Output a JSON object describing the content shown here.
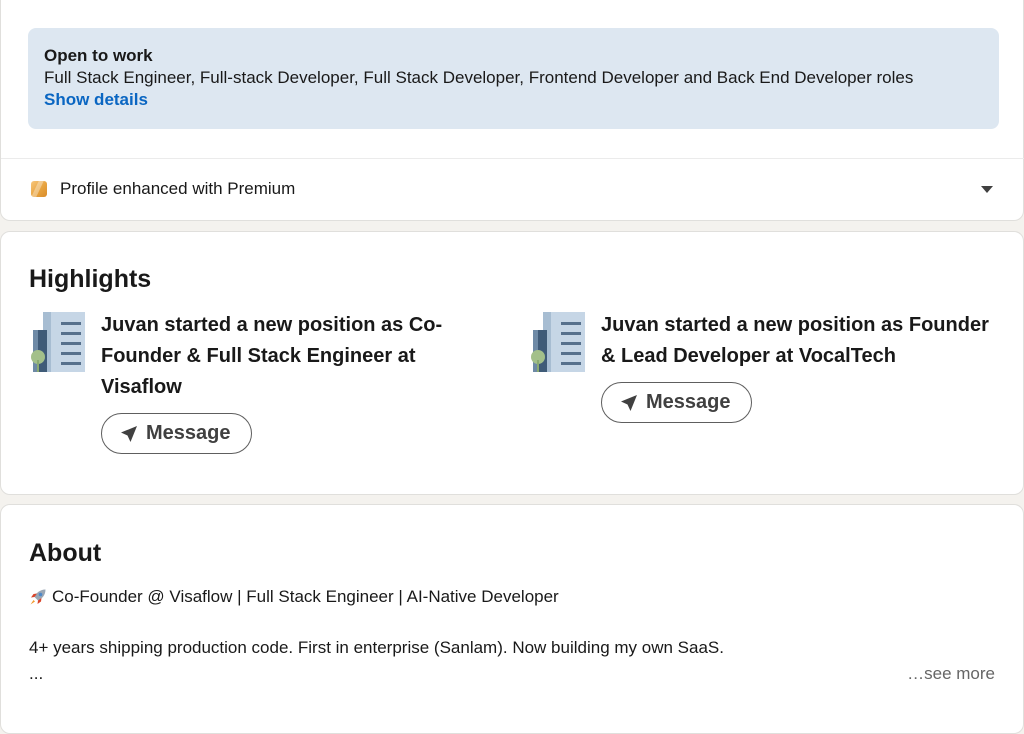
{
  "open_to_work": {
    "title": "Open to work",
    "roles": "Full Stack Engineer, Full-stack Developer, Full Stack Developer, Frontend Developer and Back End Developer roles",
    "link": "Show details"
  },
  "premium": {
    "label": "Profile enhanced with Premium",
    "icon": "premium-icon",
    "expand_icon": "chevron-down-icon"
  },
  "highlights": {
    "title": "Highlights",
    "items": [
      {
        "text": "Juvan started a new position as Co-Founder & Full Stack Engineer at Visaflow",
        "button": "Message",
        "icon": "company-building-icon"
      },
      {
        "text": "Juvan started a new position as Founder & Lead Developer at VocalTech",
        "button": "Message",
        "icon": "company-building-icon"
      }
    ]
  },
  "about": {
    "title": "About",
    "line1": "Co-Founder @ Visaflow | Full Stack Engineer | AI-Native Developer",
    "line2": "4+ years shipping production code. First in enterprise (Sanlam). Now building my own SaaS.",
    "line3": "...",
    "see_more": "…see more"
  },
  "colors": {
    "link": "#0a66c2",
    "open_to_work_bg": "#dde7f1",
    "page_bg": "#f4f2ee"
  }
}
